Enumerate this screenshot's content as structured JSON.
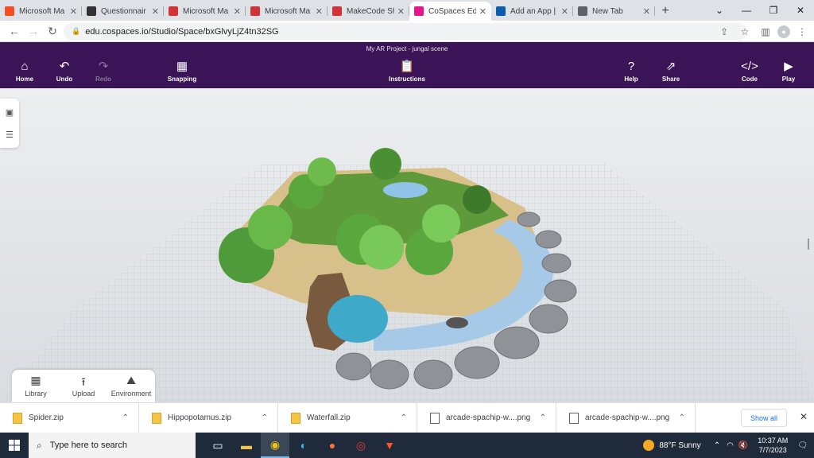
{
  "browser": {
    "tabs": [
      {
        "label": "Microsoft Ma",
        "icon": "microsoft-icon",
        "color": "#f25022"
      },
      {
        "label": "Questionnair",
        "icon": "compass-icon",
        "color": "#333333"
      },
      {
        "label": "Microsoft Ma",
        "icon": "makecode-icon",
        "color": "#d13438"
      },
      {
        "label": "Microsoft Ma",
        "icon": "makecode-icon",
        "color": "#d13438"
      },
      {
        "label": "MakeCode Sh",
        "icon": "makecode-icon",
        "color": "#d13438"
      },
      {
        "label": "CoSpaces Edu",
        "icon": "cospaces-icon",
        "color": "#e5178b",
        "active": true
      },
      {
        "label": "Add an App |",
        "icon": "app-icon",
        "color": "#0b5cad"
      },
      {
        "label": "New Tab",
        "icon": "chrome-icon",
        "color": "#5f6368"
      }
    ],
    "new_tab": "+",
    "url": "edu.cospaces.io/Studio/Space/bxGlvyLjZ4tn32SG"
  },
  "app": {
    "title": "My AR Project - jungal scene",
    "toolbar": {
      "home": "Home",
      "undo": "Undo",
      "redo": "Redo",
      "snapping": "Snapping",
      "instructions": "Instructions",
      "help": "Help",
      "share": "Share",
      "code": "Code",
      "play": "Play"
    },
    "bottom_panel": {
      "library": "Library",
      "upload": "Upload",
      "environment": "Environment"
    }
  },
  "downloads": {
    "items": [
      {
        "name": "Spider.zip",
        "type": "zip"
      },
      {
        "name": "Hippopotamus.zip",
        "type": "zip"
      },
      {
        "name": "Waterfall.zip",
        "type": "zip"
      },
      {
        "name": "arcade-spachip-w....png",
        "type": "png"
      },
      {
        "name": "arcade-spachip-w....png",
        "type": "png"
      }
    ],
    "show_all": "Show all"
  },
  "taskbar": {
    "search_placeholder": "Type here to search",
    "weather": "88°F  Sunny",
    "time": "10:37 AM",
    "date": "7/7/2023"
  },
  "colors": {
    "header": "#3a1456",
    "accent": "#e5178b"
  }
}
